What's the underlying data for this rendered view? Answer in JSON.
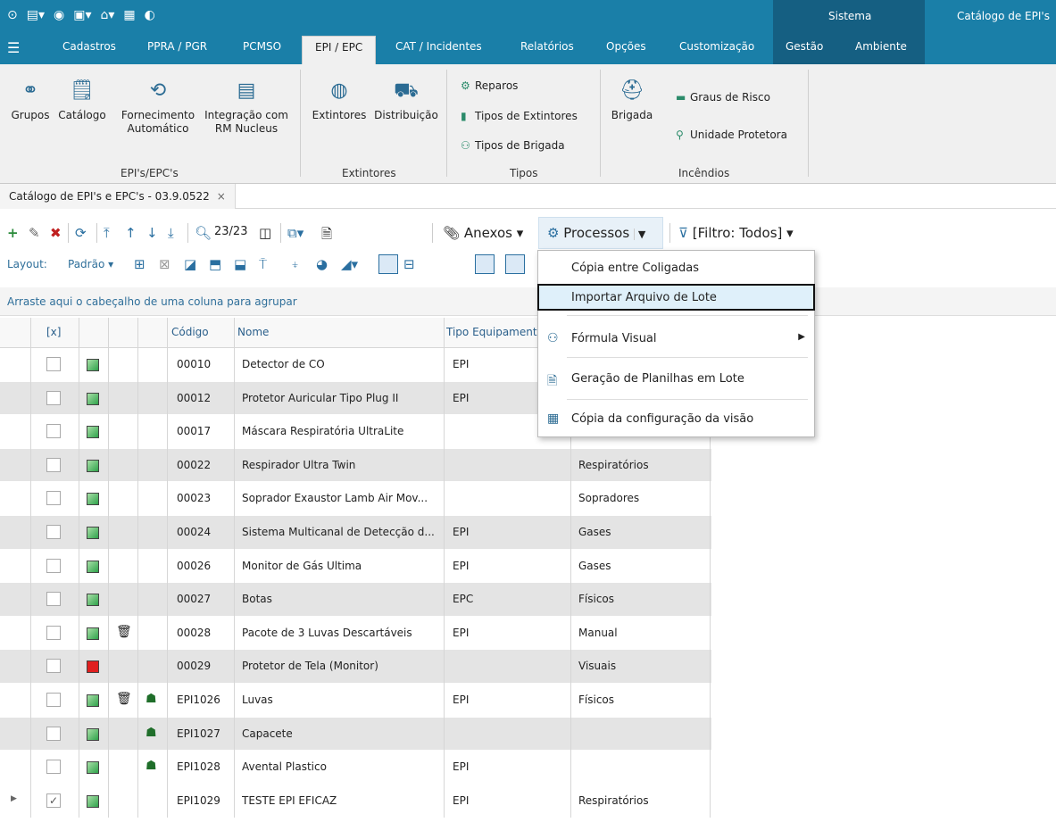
{
  "titlebar": {
    "quick_icons": [
      "⊙",
      "▤",
      "◉",
      "▣",
      "⌂",
      "▦",
      "◐"
    ],
    "sistema": "Sistema",
    "catalog": "Catálogo de EPI's"
  },
  "tabs": [
    "Cadastros",
    "PPRA / PGR",
    "PCMSO",
    "EPI / EPC",
    "CAT / Incidentes",
    "Relatórios",
    "Opções",
    "Customização",
    "Gestão",
    "Ambiente"
  ],
  "ribbon": {
    "buttons": [
      {
        "label": "Grupos",
        "icon": "group-icon"
      },
      {
        "label": "Catálogo",
        "icon": "catalog-icon"
      },
      {
        "label": "Fornecimento\nAutomático",
        "icon": "auto-supply-icon"
      },
      {
        "label": "Integração com\nRM Nucleus",
        "icon": "integration-icon"
      },
      {
        "label": "Extintores",
        "icon": "extinguisher-icon"
      },
      {
        "label": "Distribuição",
        "icon": "distribution-icon"
      },
      {
        "label": "Brigada",
        "icon": "brigade-icon"
      }
    ],
    "small": [
      "Reparos",
      "Tipos de Extintores",
      "Tipos de Brigada",
      "Graus de Risco",
      "Unidade Protetora"
    ],
    "groups": [
      "EPI's/EPC's",
      "Extintores",
      "Tipos",
      "Incêndios"
    ]
  },
  "doctab": {
    "title": "Catálogo de EPI's e EPC's - 03.9.0522",
    "close": "×"
  },
  "toolbar": {
    "count": "23/23",
    "anexos": "Anexos",
    "processos": "Processos",
    "filtro": "[Filtro: Todos]",
    "layout": "Layout:",
    "padrao": "Padrão"
  },
  "grouparea": "Arraste aqui o cabeçalho de uma coluna para agrupar",
  "grid": {
    "headers": {
      "chk": "[x]",
      "codigo": "Código",
      "nome": "Nome",
      "tipo": "Tipo Equipament"
    },
    "rows": [
      {
        "codigo": "00010",
        "nome": "Detector de CO",
        "tipo": "EPI",
        "cat": "",
        "status": "green",
        "i2": "",
        "i3": "",
        "checked": false
      },
      {
        "codigo": "00012",
        "nome": "Protetor Auricular Tipo Plug II",
        "tipo": "EPI",
        "cat": "",
        "status": "green",
        "i2": "",
        "i3": "",
        "checked": false
      },
      {
        "codigo": "00017",
        "nome": "Máscara Respiratória UltraLite",
        "tipo": "",
        "cat": "",
        "status": "green",
        "i2": "",
        "i3": "",
        "checked": false
      },
      {
        "codigo": "00022",
        "nome": "Respirador Ultra Twin",
        "tipo": "",
        "cat": "Respiratórios",
        "status": "green",
        "i2": "",
        "i3": "",
        "checked": false
      },
      {
        "codigo": "00023",
        "nome": "Soprador Exaustor Lamb Air Mov...",
        "tipo": "",
        "cat": "Sopradores",
        "status": "green",
        "i2": "",
        "i3": "",
        "checked": false
      },
      {
        "codigo": "00024",
        "nome": "Sistema Multicanal de Detecção d...",
        "tipo": "EPI",
        "cat": "Gases",
        "status": "green",
        "i2": "",
        "i3": "",
        "checked": false
      },
      {
        "codigo": "00026",
        "nome": "Monitor de Gás Ultima",
        "tipo": "EPI",
        "cat": "Gases",
        "status": "green",
        "i2": "",
        "i3": "",
        "checked": false
      },
      {
        "codigo": "00027",
        "nome": "Botas",
        "tipo": "EPC",
        "cat": "Físicos",
        "status": "green",
        "i2": "",
        "i3": "",
        "checked": false
      },
      {
        "codigo": "00028",
        "nome": "Pacote de 3 Luvas Descartáveis",
        "tipo": "EPI",
        "cat": "Manual",
        "status": "green",
        "i2": "trash",
        "i3": "",
        "checked": false
      },
      {
        "codigo": "00029",
        "nome": "Protetor de Tela (Monitor)",
        "tipo": "",
        "cat": "Visuais",
        "status": "red",
        "i2": "",
        "i3": "",
        "checked": false
      },
      {
        "codigo": "EPI1026",
        "nome": "Luvas",
        "tipo": "EPI",
        "cat": "Físicos",
        "status": "green",
        "i2": "trash",
        "i3": "boxes",
        "checked": false
      },
      {
        "codigo": "EPI1027",
        "nome": "Capacete",
        "tipo": "",
        "cat": "",
        "status": "green",
        "i2": "",
        "i3": "boxes",
        "checked": false
      },
      {
        "codigo": "EPI1028",
        "nome": "Avental Plastico",
        "tipo": "EPI",
        "cat": "",
        "status": "green",
        "i2": "",
        "i3": "boxes",
        "checked": false
      },
      {
        "codigo": "EPI1029",
        "nome": "TESTE EPI EFICAZ",
        "tipo": "EPI",
        "cat": "Respiratórios",
        "status": "green",
        "i2": "",
        "i3": "",
        "checked": true
      }
    ]
  },
  "menu": {
    "items": [
      "Cópia entre Coligadas",
      "Importar Arquivo de Lote",
      "Fórmula Visual",
      "Geração de Planilhas em Lote",
      "Cópia da configuração da visão"
    ]
  }
}
